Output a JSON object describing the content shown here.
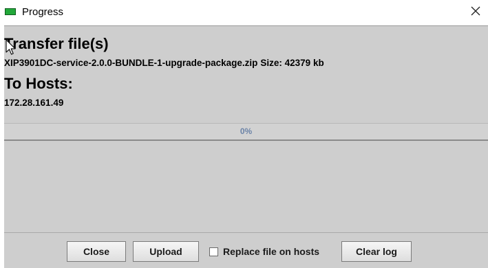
{
  "window": {
    "title": "Progress",
    "icon": "green-rectangle-app-icon",
    "close_icon": "close-x-icon"
  },
  "transfer": {
    "heading": "Transfer file(s)",
    "file_name": "XIP3901DC-service-2.0.0-BUNDLE-1-upgrade-package.zip",
    "size_text": "Size: 42379 kb"
  },
  "hosts": {
    "heading": "To Hosts:",
    "host_list": "172.28.161.49"
  },
  "progress": {
    "percent": 0,
    "label": "0%"
  },
  "buttons": {
    "close_label": "Close",
    "upload_label": "Upload",
    "replace_label": "Replace file on hosts",
    "replace_checked": false,
    "clear_log_label": "Clear log"
  },
  "colors": {
    "panel_bg": "#cecece",
    "progress_text": "#6c84a8",
    "app_icon": "#22a83a"
  }
}
